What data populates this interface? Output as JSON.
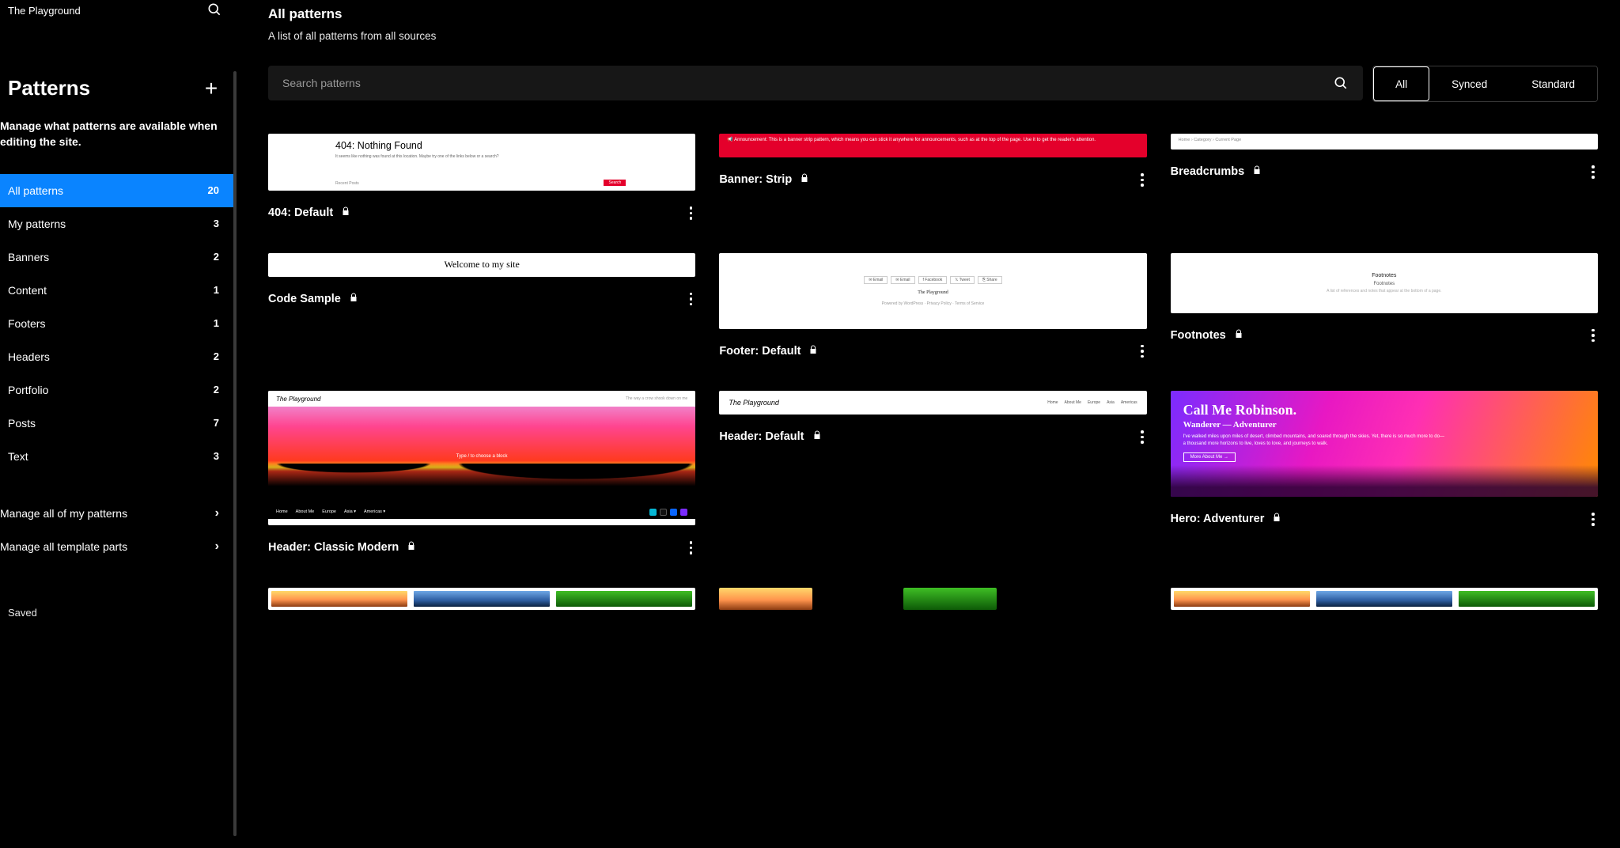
{
  "site_title": "The Playground",
  "sidebar": {
    "heading": "Patterns",
    "description": "Manage what patterns are available when editing the site.",
    "items": [
      {
        "label": "All patterns",
        "count": "20",
        "active": true
      },
      {
        "label": "My patterns",
        "count": "3"
      },
      {
        "label": "Banners",
        "count": "2"
      },
      {
        "label": "Content",
        "count": "1"
      },
      {
        "label": "Footers",
        "count": "1"
      },
      {
        "label": "Headers",
        "count": "2"
      },
      {
        "label": "Portfolio",
        "count": "2"
      },
      {
        "label": "Posts",
        "count": "7"
      },
      {
        "label": "Text",
        "count": "3"
      }
    ],
    "manage": [
      "Manage all of my patterns",
      "Manage all template parts"
    ],
    "saved": "Saved"
  },
  "main": {
    "title": "All patterns",
    "subtitle": "A list of all patterns from all sources",
    "search_placeholder": "Search patterns",
    "filters": {
      "all": "All",
      "synced": "Synced",
      "standard": "Standard"
    }
  },
  "cards": {
    "c404": {
      "title": "404: Default"
    },
    "banner": {
      "title": "Banner: Strip"
    },
    "bread": {
      "title": "Breadcrumbs"
    },
    "code": {
      "title": "Code Sample"
    },
    "footer": {
      "title": "Footer: Default"
    },
    "footnotes": {
      "title": "Footnotes"
    },
    "classic": {
      "title": "Header: Classic Modern"
    },
    "headerdef": {
      "title": "Header: Default"
    },
    "hero": {
      "title": "Hero: Adventurer"
    }
  },
  "thumbs": {
    "c404": {
      "heading": "404: Nothing Found",
      "body": "It seems like nothing was found at this location. Maybe try one of the links below or a search?",
      "button": "Search",
      "hint": "Recent Posts"
    },
    "banner": "📢 Announcement: This is a banner strip pattern, which means you can stick it anywhere for announcements, such as at the top of the page. Use it to get the reader's attention.",
    "bread": "Home › Category › Current Page",
    "code": "Welcome to my site",
    "footer": {
      "buttons": [
        "✉ Email",
        "✉ Email",
        "f Facebook",
        "𝕏 Tweet",
        "⎘ Share"
      ],
      "line1": "The Playground",
      "line2": "Powered by WordPress · Privacy Policy · Terms of Service"
    },
    "footnotes": {
      "l1": "Footnotes",
      "l2": "Footnotes",
      "l3": "A list of references and notes that appear at the bottom of a page."
    },
    "classic": {
      "brand": "The Playground",
      "tag": "The way a crow shook down on me",
      "center": "Type / to choose a block",
      "nav": [
        "Home",
        "About Me",
        "Europe",
        "Asia ▾",
        "Americas ▾"
      ]
    },
    "headerdef": {
      "brand": "The Playground",
      "nav": [
        "Home",
        "About Me",
        "Europe",
        "Asia",
        "Americas"
      ]
    },
    "hero": {
      "h": "Call Me Robinson.",
      "s": "Wanderer — Adventurer",
      "p": "I've walked miles upon miles of desert, climbed mountains, and soared through the skies. Yet, there is so much more to do—a thousand more horizons to live, loves to love, and journeys to walk.",
      "btn": "More About Me →"
    }
  }
}
